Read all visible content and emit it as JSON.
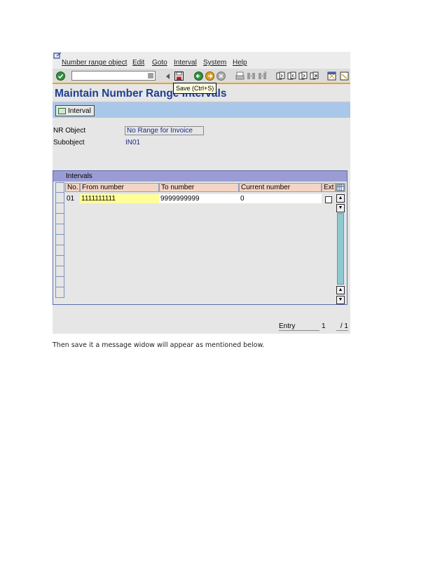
{
  "menubar": {
    "items": [
      "Number range object",
      "Edit",
      "Goto",
      "Interval",
      "System",
      "Help"
    ]
  },
  "toolbar": {
    "command_field_value": "",
    "tooltip": "Save  (Ctrl+S)",
    "icons": [
      "enter-icon",
      "back-arrow-icon",
      "save-icon",
      "back-icon",
      "exit-icon",
      "cancel-icon",
      "print-icon",
      "find-icon",
      "find-next-icon",
      "first-page-icon",
      "previous-page-icon",
      "next-page-icon",
      "last-page-icon",
      "create-session-icon",
      "shortcut-icon"
    ]
  },
  "page": {
    "title": "Maintain Number Range Intervals"
  },
  "appbar": {
    "interval_button": "Interval"
  },
  "form": {
    "nr_object_label": "NR Object",
    "nr_object_value": "No Range for Invoice",
    "subobject_label": "Subobject",
    "subobject_value": "IN01"
  },
  "table": {
    "title": "Intervals",
    "columns": [
      "No.",
      "From number",
      "To number",
      "Current number",
      "Ext"
    ],
    "rows": [
      {
        "no": "01",
        "from": "1111111111",
        "to": "9999999999",
        "current": "0",
        "ext": false
      }
    ],
    "empty_rows": 9
  },
  "footer": {
    "entry_label": "Entry",
    "entry_value": "1",
    "entry_total": "/ 1"
  },
  "caption": "Then save it a message widow will appear as mentioned below.",
  "colors": {
    "title": "#1f3f8f",
    "appbar": "#a9c7e8",
    "header_cell": "#f3d5c6",
    "from_cell_highlight": "#ffff99",
    "table_title_bar": "#9c9cd4",
    "toolbar_underline": "#f0a30a"
  }
}
